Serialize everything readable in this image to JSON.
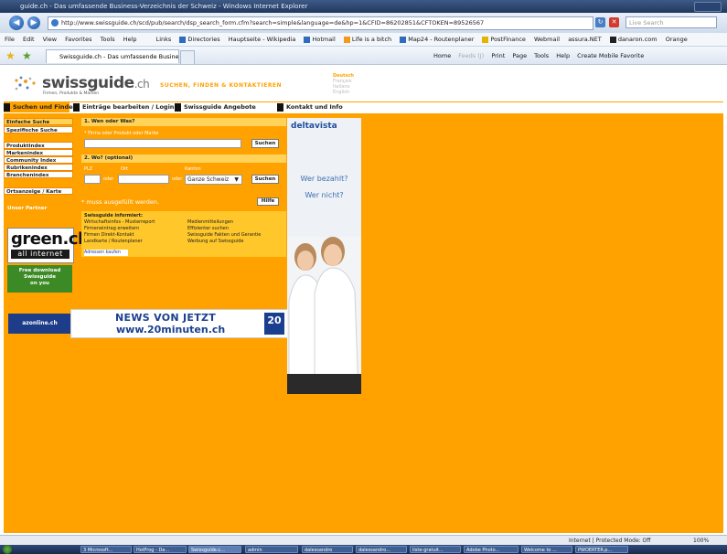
{
  "window": {
    "title": "guide.ch - Das umfassende Business-Verzeichnis der Schweiz - Windows Internet Explorer",
    "url": "http://www.swissguide.ch/scd/pub/search/dsp_search_form.cfm?search=simple&language=de&hp=1&CFID=86202851&CFTOKEN=89526567",
    "live_search_placeholder": "Live Search"
  },
  "menubar": {
    "items": [
      "File",
      "Edit",
      "View",
      "Favorites",
      "Tools",
      "Help"
    ],
    "links_label": "Links",
    "links": [
      "Directories",
      "Hauptseite - Wikipedia",
      "Hotmail",
      "Life is a bitch",
      "Map24 - Routenplaner",
      "PostFinance",
      "Webmail",
      "assura.NET",
      "danaron.com",
      "Orange"
    ]
  },
  "tabbar": {
    "tab_title": "Swissguide.ch - Das umfassende Business-Verzei...",
    "commands": [
      "Home",
      "Feeds (J)",
      "Print",
      "Page",
      "Tools",
      "Help",
      "Create Mobile Favorite"
    ]
  },
  "header": {
    "logo_main": "swissguide",
    "logo_tld": ".ch",
    "logo_sub": "Firmen, Produkte & Marken",
    "slogan": "SUCHEN, FINDEN & KONTAKTIEREN",
    "languages": [
      "Deutsch",
      "Français",
      "Italiano",
      "English"
    ]
  },
  "nav": {
    "items": [
      "Suchen und Finden",
      "Einträge bearbeiten / Login",
      "Swissguide Angebote",
      "Kontakt und Info"
    ]
  },
  "sidebar": {
    "items": [
      "Einfache Suche",
      "Spezifische Suche",
      "Produktindex",
      "Markenindex",
      "Community Index",
      "Rubrikenindex",
      "Branchenindex",
      "Ortsanzeige / Karte"
    ],
    "partner_label": "Unser Partner",
    "green_logo": "green.ch",
    "green_sub": "all internet",
    "free_download": [
      "Free download",
      "Swissguide",
      "on you"
    ],
    "azonline": "azonline.ch"
  },
  "form": {
    "section1": "1. Wen oder Was?",
    "hint1": "* Firma oder Produkt oder Marke",
    "search_button": "Suchen",
    "section2": "2. Wo? (optional)",
    "plz_label": "PLZ",
    "ort_label": "Ort",
    "kanton_label": "Kanton",
    "oder1": "oder",
    "oder2": "oder",
    "kanton_value": "Ganze Schweiz",
    "search_button2": "Suchen",
    "required_note": "* muss ausgefüllt werden.",
    "help_button": "Hilfe"
  },
  "info": {
    "heading": "Swissguide informiert:",
    "links": [
      "Wirtschaftsinfos - Musterreport",
      "Medienmitteilungen",
      "Firmeneintrag erweitern",
      "Effizienter suchen",
      "Firmen Direkt-Kontakt",
      "Swissguide Fakten und Gerantie",
      "Landkarte / Routenplaner",
      "Werbung auf Swissguide",
      "Adressen kaufen"
    ]
  },
  "news_banner": {
    "line1": "NEWS VON JETZT",
    "line2": "www.20minuten.ch",
    "logo": "20"
  },
  "ad": {
    "brand": "deltavista",
    "q1": "Wer bezahlt?",
    "q2": "Wer nicht?"
  },
  "status": {
    "zone": "Internet | Protected Mode: Off",
    "zoom": "100%"
  },
  "taskbar": {
    "tasks": [
      "3 Microsoft...",
      "HotFrog - Da...",
      "Swissguide.c...",
      "admin",
      "dalessandro",
      "dalessandro...",
      "liste-gratuit...",
      "Adobe Photo...",
      "Welcome to ...",
      "PWOERTER.p..."
    ]
  }
}
